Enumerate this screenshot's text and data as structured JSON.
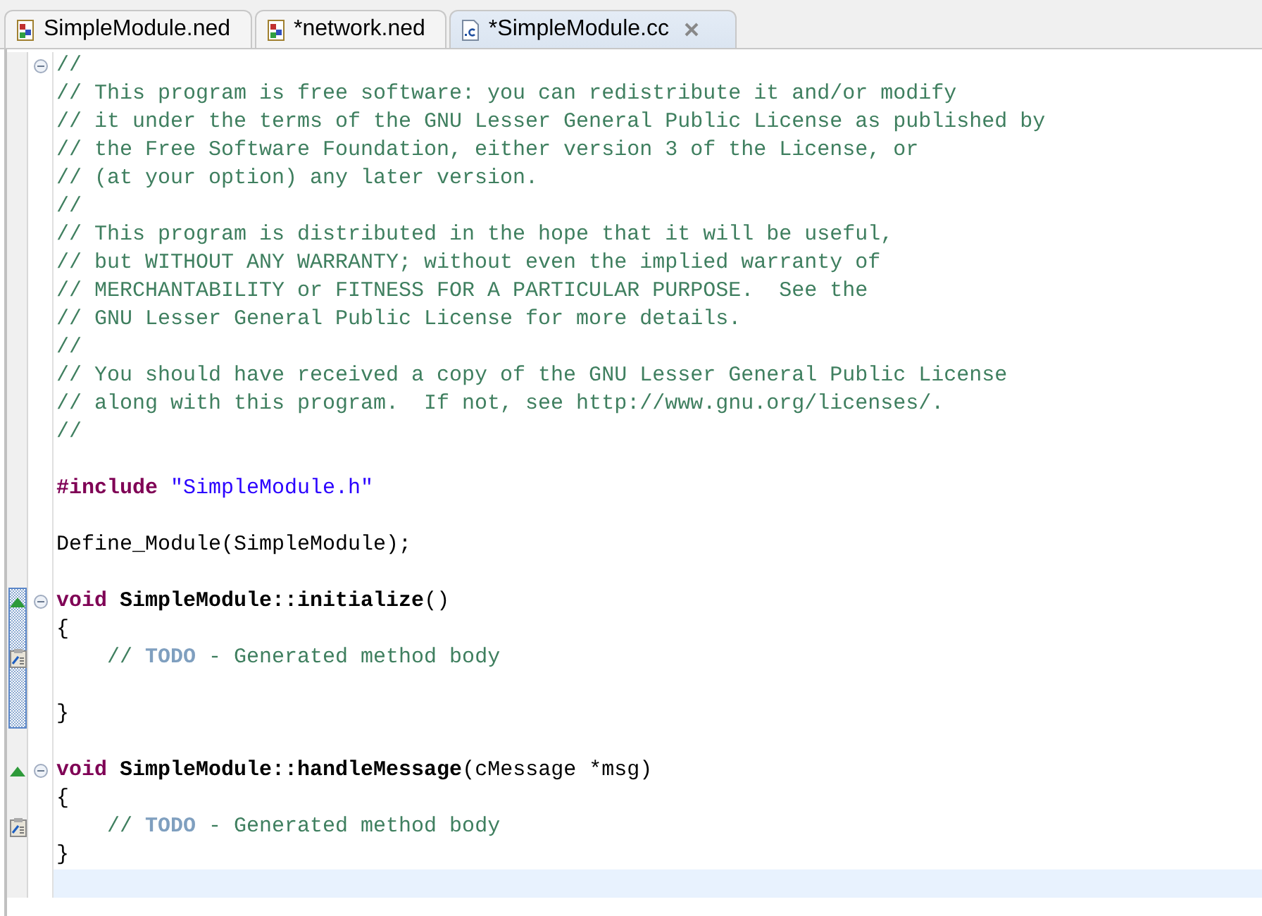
{
  "tabs": [
    {
      "label": "SimpleModule.ned",
      "kind": "ned",
      "selected": false,
      "closable": false
    },
    {
      "label": "*network.ned",
      "kind": "ned",
      "selected": false,
      "closable": false
    },
    {
      "label": "*SimpleModule.cc",
      "kind": "cc",
      "selected": true,
      "closable": true
    }
  ],
  "editor": {
    "lines": [
      {
        "fold": true,
        "tokens": [
          {
            "kind": "comment",
            "text": "//"
          }
        ]
      },
      {
        "tokens": [
          {
            "kind": "comment",
            "text": "// This program is free software: you can redistribute it and/or modify"
          }
        ]
      },
      {
        "tokens": [
          {
            "kind": "comment",
            "text": "// it under the terms of the GNU Lesser General Public License as published by"
          }
        ]
      },
      {
        "tokens": [
          {
            "kind": "comment",
            "text": "// the Free Software Foundation, either version 3 of the License, or"
          }
        ]
      },
      {
        "tokens": [
          {
            "kind": "comment",
            "text": "// (at your option) any later version."
          }
        ]
      },
      {
        "tokens": [
          {
            "kind": "comment",
            "text": "//"
          }
        ]
      },
      {
        "tokens": [
          {
            "kind": "comment",
            "text": "// This program is distributed in the hope that it will be useful,"
          }
        ]
      },
      {
        "tokens": [
          {
            "kind": "comment",
            "text": "// but WITHOUT ANY WARRANTY; without even the implied warranty of"
          }
        ]
      },
      {
        "tokens": [
          {
            "kind": "comment",
            "text": "// MERCHANTABILITY or FITNESS FOR A PARTICULAR PURPOSE.  See the"
          }
        ]
      },
      {
        "tokens": [
          {
            "kind": "comment",
            "text": "// GNU Lesser General Public License for more details."
          }
        ]
      },
      {
        "tokens": [
          {
            "kind": "comment",
            "text": "//"
          }
        ]
      },
      {
        "tokens": [
          {
            "kind": "comment",
            "text": "// You should have received a copy of the GNU Lesser General Public License"
          }
        ]
      },
      {
        "tokens": [
          {
            "kind": "comment",
            "text": "// along with this program.  If not, see http://www.gnu.org/licenses/."
          }
        ]
      },
      {
        "tokens": [
          {
            "kind": "comment",
            "text": "//"
          }
        ]
      },
      {
        "blank_before": true,
        "tokens": [
          {
            "kind": "keyword",
            "text": "#include"
          },
          {
            "kind": "string",
            "text": " \"SimpleModule.h\""
          }
        ]
      },
      {
        "blank_before": true,
        "tokens": [
          {
            "kind": "plain",
            "text": "Define_Module(SimpleModule);"
          }
        ]
      },
      {
        "blank_before": true,
        "fold": true,
        "overridden": true,
        "range": true,
        "tokens": [
          {
            "kind": "keyword",
            "text": "void"
          },
          {
            "kind": "method",
            "text": " SimpleModule::initialize"
          },
          {
            "kind": "plain",
            "text": "()"
          }
        ]
      },
      {
        "range": true,
        "tokens": [
          {
            "kind": "plain",
            "text": "{"
          }
        ]
      },
      {
        "task": true,
        "range": true,
        "indent": true,
        "tokens": [
          {
            "kind": "comment",
            "text": "// "
          },
          {
            "kind": "task",
            "text": "TODO"
          },
          {
            "kind": "comment",
            "text": " - Generated method body"
          }
        ]
      },
      {
        "range": true
      },
      {
        "range": true,
        "tokens": [
          {
            "kind": "plain",
            "text": "}"
          }
        ]
      },
      {
        "blank_before": true,
        "fold": true,
        "overridden": true,
        "tokens": [
          {
            "kind": "keyword",
            "text": "void"
          },
          {
            "kind": "method",
            "text": " SimpleModule::handleMessage"
          },
          {
            "kind": "plain",
            "text": "(cMessage *msg)"
          }
        ]
      },
      {
        "tokens": [
          {
            "kind": "plain",
            "text": "{"
          }
        ]
      },
      {
        "task": true,
        "indent": true,
        "tokens": [
          {
            "kind": "comment",
            "text": "// "
          },
          {
            "kind": "task",
            "text": "TODO"
          },
          {
            "kind": "comment",
            "text": " - Generated method body"
          }
        ]
      },
      {
        "tokens": [
          {
            "kind": "plain",
            "text": "}"
          }
        ]
      },
      {
        "current": true
      }
    ]
  }
}
